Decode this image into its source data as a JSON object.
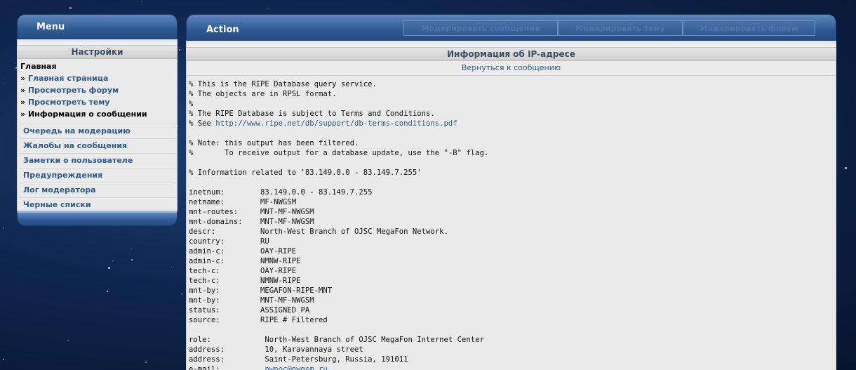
{
  "menu": {
    "title": "Menu",
    "section": "Настройки",
    "group_title": "Главная",
    "group_items": [
      {
        "label": "Главная страница"
      },
      {
        "label": "Просмотреть форум"
      },
      {
        "label": "Просмотреть тему"
      },
      {
        "label": "Информация о сообщении"
      }
    ],
    "links": [
      {
        "label": "Очередь на модерацию"
      },
      {
        "label": "Жалобы на сообщения"
      },
      {
        "label": "Заметки о пользователе"
      },
      {
        "label": "Предупреждения"
      },
      {
        "label": "Лог модератора"
      },
      {
        "label": "Черные списки"
      }
    ],
    "bullet": "»"
  },
  "action": {
    "title": "Action",
    "buttons": [
      {
        "label": "Модерировать сообщение"
      },
      {
        "label": "Модерировать тему"
      },
      {
        "label": "Модерировать форум"
      }
    ]
  },
  "content": {
    "title": "Информация об IP-адресе",
    "back_link": "Вернуться к сообщению",
    "lines": [
      {
        "pre": "% This is the RIPE Database query service."
      },
      {
        "pre": "% The objects are in RPSL format."
      },
      {
        "pre": "%"
      },
      {
        "pre": "% The RIPE Database is subject to Terms and Conditions."
      },
      {
        "pre": "% See ",
        "link": "http://www.ripe.net/db/support/db-terms-conditions.pdf"
      },
      {
        "pre": ""
      },
      {
        "pre": "% Note: this output has been filtered."
      },
      {
        "pre": "%       To receive output for a database update, use the \"-B\" flag."
      },
      {
        "pre": ""
      },
      {
        "pre": "% Information related to '83.149.0.0 - 83.149.7.255'"
      },
      {
        "pre": ""
      },
      {
        "pre": "inetnum:        83.149.0.0 - 83.149.7.255"
      },
      {
        "pre": "netname:        MF-NWGSM"
      },
      {
        "pre": "mnt-routes:     MNT-MF-NWGSM"
      },
      {
        "pre": "mnt-domains:    MNT-MF-NWGSM"
      },
      {
        "pre": "descr:          North-West Branch of OJSC MegaFon Network."
      },
      {
        "pre": "country:        RU"
      },
      {
        "pre": "admin-c:        OAY-RIPE"
      },
      {
        "pre": "admin-c:        NMNW-RIPE"
      },
      {
        "pre": "tech-c:         OAY-RIPE"
      },
      {
        "pre": "tech-c:         NMNW-RIPE"
      },
      {
        "pre": "mnt-by:         MEGAFON-RIPE-MNT"
      },
      {
        "pre": "mnt-by:         MNT-MF-NWGSM"
      },
      {
        "pre": "status:         ASSIGNED PA"
      },
      {
        "pre": "source:         RIPE # Filtered"
      },
      {
        "pre": ""
      },
      {
        "pre": "role:            North-West Branch of OJSC MegaFon Internet Center"
      },
      {
        "pre": "address:         10, Karavannaya street"
      },
      {
        "pre": "address:         Saint-Petersburg, Russia, 191011"
      },
      {
        "pre": "e-mail:          ",
        "link": "nwnoc@nwgsm.ru"
      }
    ]
  }
}
